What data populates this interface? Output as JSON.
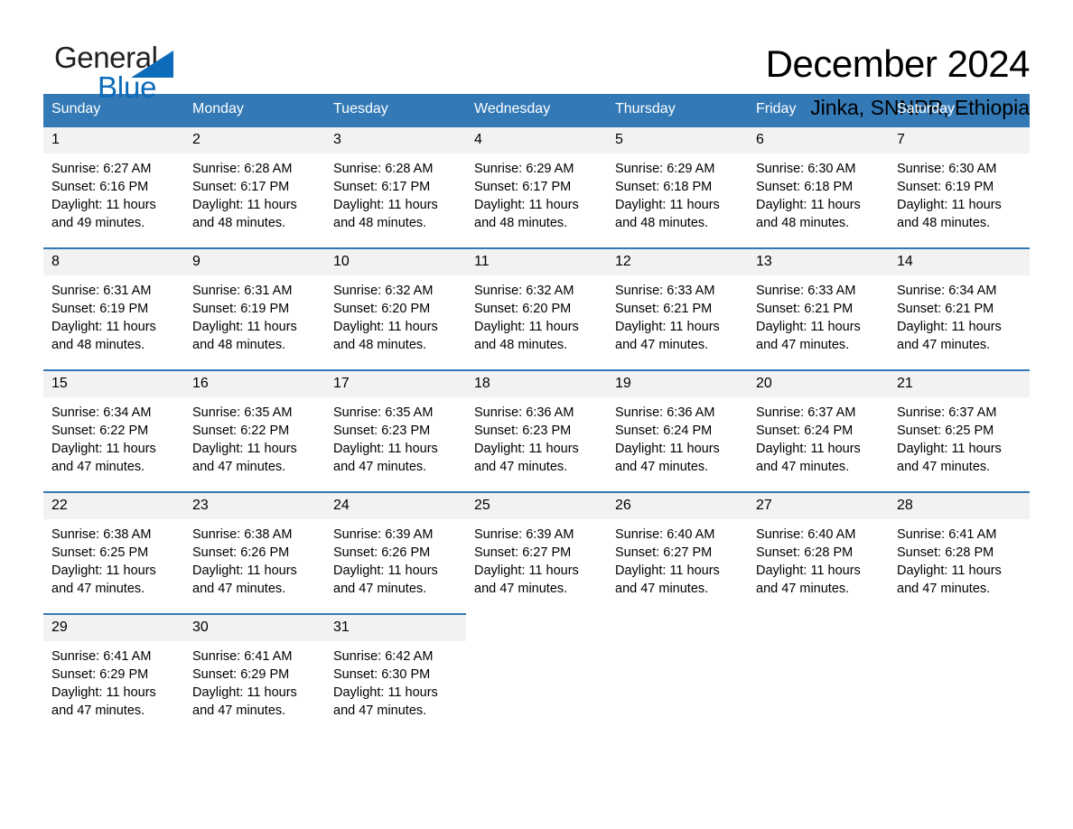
{
  "brand": {
    "name_part1": "General",
    "name_part2": "Blue",
    "accent_color": "#0d6cb9",
    "triangle_icon": "triangle-icon"
  },
  "header": {
    "month_title": "December 2024",
    "location": "Jinka, SNNPR, Ethiopia"
  },
  "calendar": {
    "header_color": "#3279b6",
    "daynum_bg": "#f2f2f2",
    "weekdays": [
      "Sunday",
      "Monday",
      "Tuesday",
      "Wednesday",
      "Thursday",
      "Friday",
      "Saturday"
    ],
    "weeks": [
      [
        {
          "day": "1",
          "sunrise": "Sunrise: 6:27 AM",
          "sunset": "Sunset: 6:16 PM",
          "daylight1": "Daylight: 11 hours",
          "daylight2": "and 49 minutes."
        },
        {
          "day": "2",
          "sunrise": "Sunrise: 6:28 AM",
          "sunset": "Sunset: 6:17 PM",
          "daylight1": "Daylight: 11 hours",
          "daylight2": "and 48 minutes."
        },
        {
          "day": "3",
          "sunrise": "Sunrise: 6:28 AM",
          "sunset": "Sunset: 6:17 PM",
          "daylight1": "Daylight: 11 hours",
          "daylight2": "and 48 minutes."
        },
        {
          "day": "4",
          "sunrise": "Sunrise: 6:29 AM",
          "sunset": "Sunset: 6:17 PM",
          "daylight1": "Daylight: 11 hours",
          "daylight2": "and 48 minutes."
        },
        {
          "day": "5",
          "sunrise": "Sunrise: 6:29 AM",
          "sunset": "Sunset: 6:18 PM",
          "daylight1": "Daylight: 11 hours",
          "daylight2": "and 48 minutes."
        },
        {
          "day": "6",
          "sunrise": "Sunrise: 6:30 AM",
          "sunset": "Sunset: 6:18 PM",
          "daylight1": "Daylight: 11 hours",
          "daylight2": "and 48 minutes."
        },
        {
          "day": "7",
          "sunrise": "Sunrise: 6:30 AM",
          "sunset": "Sunset: 6:19 PM",
          "daylight1": "Daylight: 11 hours",
          "daylight2": "and 48 minutes."
        }
      ],
      [
        {
          "day": "8",
          "sunrise": "Sunrise: 6:31 AM",
          "sunset": "Sunset: 6:19 PM",
          "daylight1": "Daylight: 11 hours",
          "daylight2": "and 48 minutes."
        },
        {
          "day": "9",
          "sunrise": "Sunrise: 6:31 AM",
          "sunset": "Sunset: 6:19 PM",
          "daylight1": "Daylight: 11 hours",
          "daylight2": "and 48 minutes."
        },
        {
          "day": "10",
          "sunrise": "Sunrise: 6:32 AM",
          "sunset": "Sunset: 6:20 PM",
          "daylight1": "Daylight: 11 hours",
          "daylight2": "and 48 minutes."
        },
        {
          "day": "11",
          "sunrise": "Sunrise: 6:32 AM",
          "sunset": "Sunset: 6:20 PM",
          "daylight1": "Daylight: 11 hours",
          "daylight2": "and 48 minutes."
        },
        {
          "day": "12",
          "sunrise": "Sunrise: 6:33 AM",
          "sunset": "Sunset: 6:21 PM",
          "daylight1": "Daylight: 11 hours",
          "daylight2": "and 47 minutes."
        },
        {
          "day": "13",
          "sunrise": "Sunrise: 6:33 AM",
          "sunset": "Sunset: 6:21 PM",
          "daylight1": "Daylight: 11 hours",
          "daylight2": "and 47 minutes."
        },
        {
          "day": "14",
          "sunrise": "Sunrise: 6:34 AM",
          "sunset": "Sunset: 6:21 PM",
          "daylight1": "Daylight: 11 hours",
          "daylight2": "and 47 minutes."
        }
      ],
      [
        {
          "day": "15",
          "sunrise": "Sunrise: 6:34 AM",
          "sunset": "Sunset: 6:22 PM",
          "daylight1": "Daylight: 11 hours",
          "daylight2": "and 47 minutes."
        },
        {
          "day": "16",
          "sunrise": "Sunrise: 6:35 AM",
          "sunset": "Sunset: 6:22 PM",
          "daylight1": "Daylight: 11 hours",
          "daylight2": "and 47 minutes."
        },
        {
          "day": "17",
          "sunrise": "Sunrise: 6:35 AM",
          "sunset": "Sunset: 6:23 PM",
          "daylight1": "Daylight: 11 hours",
          "daylight2": "and 47 minutes."
        },
        {
          "day": "18",
          "sunrise": "Sunrise: 6:36 AM",
          "sunset": "Sunset: 6:23 PM",
          "daylight1": "Daylight: 11 hours",
          "daylight2": "and 47 minutes."
        },
        {
          "day": "19",
          "sunrise": "Sunrise: 6:36 AM",
          "sunset": "Sunset: 6:24 PM",
          "daylight1": "Daylight: 11 hours",
          "daylight2": "and 47 minutes."
        },
        {
          "day": "20",
          "sunrise": "Sunrise: 6:37 AM",
          "sunset": "Sunset: 6:24 PM",
          "daylight1": "Daylight: 11 hours",
          "daylight2": "and 47 minutes."
        },
        {
          "day": "21",
          "sunrise": "Sunrise: 6:37 AM",
          "sunset": "Sunset: 6:25 PM",
          "daylight1": "Daylight: 11 hours",
          "daylight2": "and 47 minutes."
        }
      ],
      [
        {
          "day": "22",
          "sunrise": "Sunrise: 6:38 AM",
          "sunset": "Sunset: 6:25 PM",
          "daylight1": "Daylight: 11 hours",
          "daylight2": "and 47 minutes."
        },
        {
          "day": "23",
          "sunrise": "Sunrise: 6:38 AM",
          "sunset": "Sunset: 6:26 PM",
          "daylight1": "Daylight: 11 hours",
          "daylight2": "and 47 minutes."
        },
        {
          "day": "24",
          "sunrise": "Sunrise: 6:39 AM",
          "sunset": "Sunset: 6:26 PM",
          "daylight1": "Daylight: 11 hours",
          "daylight2": "and 47 minutes."
        },
        {
          "day": "25",
          "sunrise": "Sunrise: 6:39 AM",
          "sunset": "Sunset: 6:27 PM",
          "daylight1": "Daylight: 11 hours",
          "daylight2": "and 47 minutes."
        },
        {
          "day": "26",
          "sunrise": "Sunrise: 6:40 AM",
          "sunset": "Sunset: 6:27 PM",
          "daylight1": "Daylight: 11 hours",
          "daylight2": "and 47 minutes."
        },
        {
          "day": "27",
          "sunrise": "Sunrise: 6:40 AM",
          "sunset": "Sunset: 6:28 PM",
          "daylight1": "Daylight: 11 hours",
          "daylight2": "and 47 minutes."
        },
        {
          "day": "28",
          "sunrise": "Sunrise: 6:41 AM",
          "sunset": "Sunset: 6:28 PM",
          "daylight1": "Daylight: 11 hours",
          "daylight2": "and 47 minutes."
        }
      ],
      [
        {
          "day": "29",
          "sunrise": "Sunrise: 6:41 AM",
          "sunset": "Sunset: 6:29 PM",
          "daylight1": "Daylight: 11 hours",
          "daylight2": "and 47 minutes."
        },
        {
          "day": "30",
          "sunrise": "Sunrise: 6:41 AM",
          "sunset": "Sunset: 6:29 PM",
          "daylight1": "Daylight: 11 hours",
          "daylight2": "and 47 minutes."
        },
        {
          "day": "31",
          "sunrise": "Sunrise: 6:42 AM",
          "sunset": "Sunset: 6:30 PM",
          "daylight1": "Daylight: 11 hours",
          "daylight2": "and 47 minutes."
        },
        {
          "day": "",
          "sunrise": "",
          "sunset": "",
          "daylight1": "",
          "daylight2": ""
        },
        {
          "day": "",
          "sunrise": "",
          "sunset": "",
          "daylight1": "",
          "daylight2": ""
        },
        {
          "day": "",
          "sunrise": "",
          "sunset": "",
          "daylight1": "",
          "daylight2": ""
        },
        {
          "day": "",
          "sunrise": "",
          "sunset": "",
          "daylight1": "",
          "daylight2": ""
        }
      ]
    ]
  }
}
